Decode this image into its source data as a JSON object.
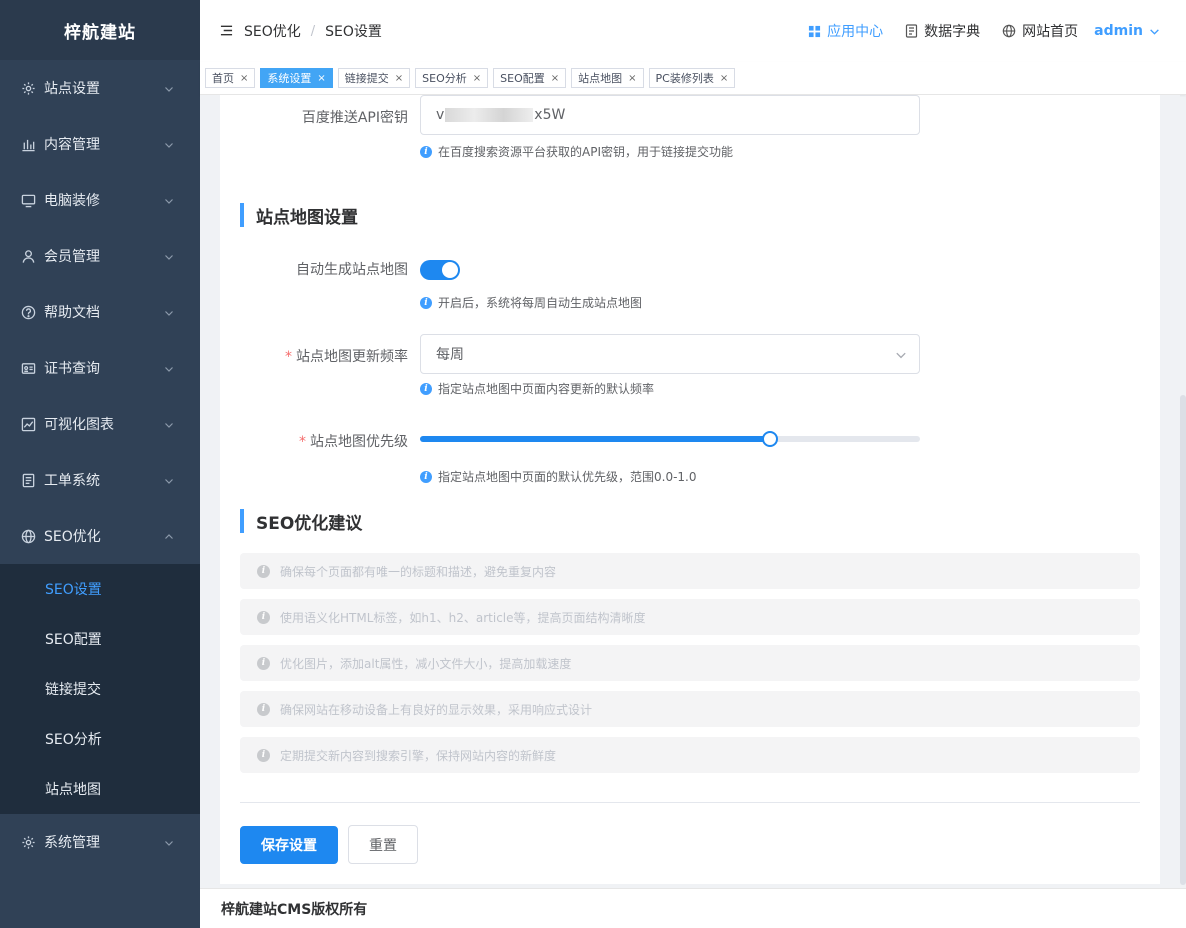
{
  "sidebar": {
    "brand": "梓航建站",
    "items": [
      {
        "label": "站点设置",
        "icon": "gear-icon"
      },
      {
        "label": "内容管理",
        "icon": "bar-chart-icon"
      },
      {
        "label": "电脑装修",
        "icon": "monitor-icon"
      },
      {
        "label": "会员管理",
        "icon": "user-icon"
      },
      {
        "label": "帮助文档",
        "icon": "help-icon"
      },
      {
        "label": "证书查询",
        "icon": "certificate-icon"
      },
      {
        "label": "可视化图表",
        "icon": "line-chart-icon"
      },
      {
        "label": "工单系统",
        "icon": "ticket-icon"
      },
      {
        "label": "SEO优化",
        "icon": "globe-icon"
      }
    ],
    "seo_sub": [
      "SEO设置",
      "SEO配置",
      "链接提交",
      "SEO分析",
      "站点地图"
    ],
    "system": {
      "label": "系统管理",
      "icon": "gear-icon"
    }
  },
  "header": {
    "breadcrumb": [
      "SEO优化",
      "SEO设置"
    ],
    "app_center": "应用中心",
    "dict": "数据字典",
    "home": "网站首页",
    "user": "admin"
  },
  "tags": [
    "首页",
    "系统设置",
    "链接提交",
    "SEO分析",
    "SEO配置",
    "站点地图",
    "PC装修列表"
  ],
  "form": {
    "api_key": {
      "label": "百度推送API密钥",
      "value_prefix": "v",
      "value_suffix": "x5W",
      "hint": "在百度搜索资源平台获取的API密钥，用于链接提交功能"
    },
    "sitemap_title": "站点地图设置",
    "auto_sitemap": {
      "label": "自动生成站点地图",
      "enabled": true,
      "hint": "开启后，系统将每周自动生成站点地图"
    },
    "frequency": {
      "label": "站点地图更新频率",
      "value": "每周",
      "hint": "指定站点地图中页面内容更新的默认频率"
    },
    "priority": {
      "label": "站点地图优先级",
      "value": 0.7,
      "hint": "指定站点地图中页面的默认优先级，范围0.0-1.0"
    },
    "required_mark": "*"
  },
  "suggestions": {
    "title": "SEO优化建议",
    "items": [
      "确保每个页面都有唯一的标题和描述，避免重复内容",
      "使用语义化HTML标签，如h1、h2、article等，提高页面结构清晰度",
      "优化图片，添加alt属性，减小文件大小，提高加载速度",
      "确保网站在移动设备上有良好的显示效果，采用响应式设计",
      "定期提交新内容到搜索引擎，保持网站内容的新鲜度"
    ]
  },
  "buttons": {
    "save": "保存设置",
    "reset": "重置"
  },
  "footer": "梓航建站CMS版权所有",
  "colors": {
    "primary": "#1e88f0",
    "sidebar": "#304156",
    "submenu": "#1f2d3d"
  }
}
